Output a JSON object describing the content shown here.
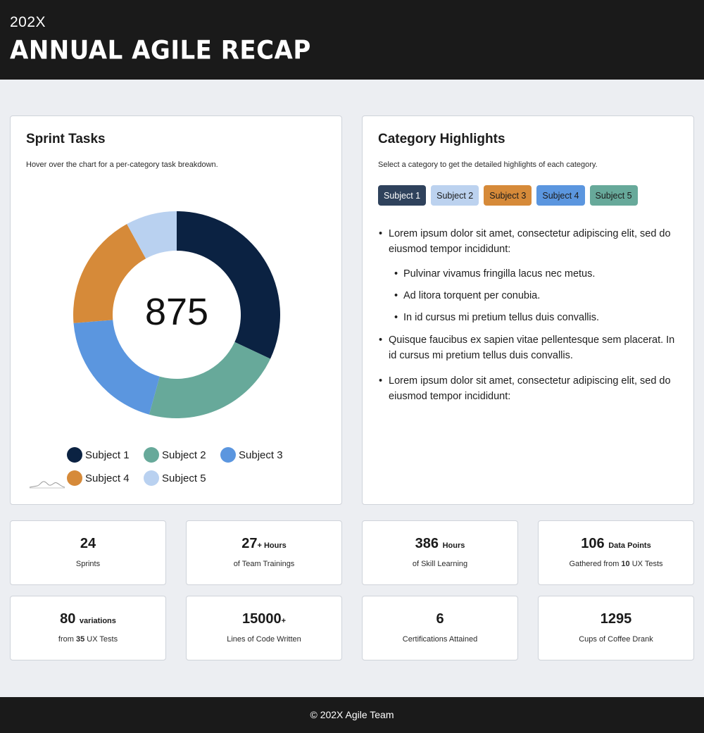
{
  "header": {
    "year": "202X",
    "title": "ANNUAL AGILE RECAP"
  },
  "sprint_card": {
    "title": "Sprint Tasks",
    "subtitle": "Hover over the chart for a per-category task breakdown.",
    "total": "875"
  },
  "chart_data": {
    "type": "pie",
    "title": "",
    "categories": [
      "Subject 1",
      "Subject 2",
      "Subject 3",
      "Subject 4",
      "Subject 5"
    ],
    "values": [
      280,
      195,
      170,
      160,
      70
    ],
    "colors": [
      "#0b2242",
      "#67a99a",
      "#5b96df",
      "#d68a39",
      "#b9d1f0"
    ],
    "legend_position": "bottom",
    "donut": true
  },
  "highlights_card": {
    "title": "Category Highlights",
    "subtitle": "Select a category to get the detailed highlights of each category.",
    "tabs": [
      {
        "label": "Subject 1",
        "bg": "#2f425c",
        "fg": "#ffffff"
      },
      {
        "label": "Subject 2",
        "bg": "#bcd2ef",
        "fg": "#1b1b1b"
      },
      {
        "label": "Subject 3",
        "bg": "#d68a39",
        "fg": "#1b1b1b"
      },
      {
        "label": "Subject 4",
        "bg": "#5b96df",
        "fg": "#1b1b1b"
      },
      {
        "label": "Subject 5",
        "bg": "#67a99a",
        "fg": "#1b1b1b"
      }
    ],
    "items": [
      {
        "text": "Lorem ipsum dolor sit amet, consectetur adipiscing elit, sed do eiusmod tempor incididunt:",
        "sub": [
          "Pulvinar vivamus fringilla lacus nec metus.",
          "Ad litora torquent per conubia.",
          "In id cursus mi pretium tellus duis convallis."
        ]
      },
      {
        "text": "Quisque faucibus ex sapien vitae pellentesque sem placerat. In id cursus mi pretium tellus duis convallis.",
        "sub": []
      },
      {
        "text": "Lorem ipsum dolor sit amet, consectetur adipiscing elit, sed do eiusmod tempor incididunt:",
        "sub": []
      }
    ]
  },
  "stats": [
    {
      "value": "24",
      "unit": "",
      "desc_pre": "Sprints",
      "desc_bold": "",
      "desc_post": ""
    },
    {
      "value": "27",
      "unit": "+ Hours",
      "desc_pre": "of Team Trainings",
      "desc_bold": "",
      "desc_post": ""
    },
    {
      "value": "386",
      "unit": "Hours",
      "desc_pre": "of Skill Learning",
      "desc_bold": "",
      "desc_post": ""
    },
    {
      "value": "106",
      "unit": "Data Points",
      "desc_pre": "Gathered from ",
      "desc_bold": "10",
      "desc_post": " UX Tests"
    },
    {
      "value": "80",
      "unit": "variations",
      "desc_pre": "from ",
      "desc_bold": "35",
      "desc_post": " UX Tests"
    },
    {
      "value": "15000",
      "unit": "+",
      "desc_pre": "Lines of Code Written",
      "desc_bold": "",
      "desc_post": ""
    },
    {
      "value": "6",
      "unit": "",
      "desc_pre": "Certifications Attained",
      "desc_bold": "",
      "desc_post": ""
    },
    {
      "value": "1295",
      "unit": "",
      "desc_pre": "Cups of Coffee Drank",
      "desc_bold": "",
      "desc_post": ""
    }
  ],
  "footer": {
    "text": "© 202X Agile Team"
  }
}
